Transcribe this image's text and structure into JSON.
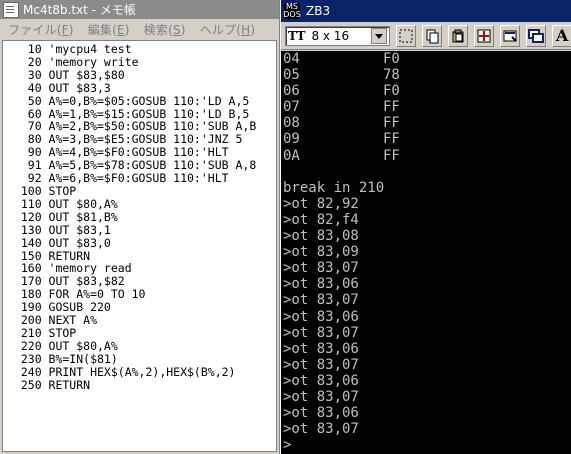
{
  "left_window": {
    "title": "Mc4t8b.txt - メモ帳",
    "menu": [
      {
        "label": "ファイル(",
        "hotkey": "F",
        "suffix": ")"
      },
      {
        "label": "編集(",
        "hotkey": "E",
        "suffix": ")"
      },
      {
        "label": "検索(",
        "hotkey": "S",
        "suffix": ")"
      },
      {
        "label": "ヘルプ(",
        "hotkey": "H",
        "suffix": ")"
      }
    ],
    "code_lines": [
      "   10 'mycpu4 test",
      "   20 'memory write",
      "   30 OUT $83,$80",
      "   40 OUT $83,3",
      "   50 A%=0,B%=$05:GOSUB 110:'LD A,5",
      "   60 A%=1,B%=$15:GOSUB 110:'LD B,5",
      "   70 A%=2,B%=$50:GOSUB 110:'SUB A,B",
      "   80 A%=3,B%=$E5:GOSUB 110:'JNZ 5",
      "   90 A%=4,B%=$F0:GOSUB 110:'HLT",
      "   91 A%=5,B%=$78:GOSUB 110:'SUB A,8",
      "   92 A%=6,B%=$F0:GOSUB 110:'HLT",
      "  100 STOP",
      "  110 OUT $80,A%",
      "  120 OUT $81,B%",
      "  130 OUT $83,1",
      "  140 OUT $83,0",
      "  150 RETURN",
      "  160 'memory read",
      "  170 OUT $83,$82",
      "  180 FOR A%=0 TO 10",
      "  190 GOSUB 220",
      "  200 NEXT A%",
      "  210 STOP",
      "  220 OUT $80,A%",
      "  230 B%=IN($81)",
      "  240 PRINT HEX$(A%,2),HEX$(B%,2)",
      "  250 RETURN"
    ]
  },
  "right_window": {
    "title": "ZB3",
    "font_size_value": "8 x 16",
    "toolbar_buttons": [
      {
        "name": "select-icon"
      },
      {
        "name": "copy-icon"
      },
      {
        "name": "paste-icon"
      },
      {
        "name": "fullscreen-icon"
      },
      {
        "name": "properties-icon"
      },
      {
        "name": "background-icon"
      },
      {
        "name": "font-icon",
        "label": "A"
      }
    ],
    "memory_rows": [
      {
        "addr": "04",
        "val": "F0"
      },
      {
        "addr": "05",
        "val": "78"
      },
      {
        "addr": "06",
        "val": "F0"
      },
      {
        "addr": "07",
        "val": "FF"
      },
      {
        "addr": "08",
        "val": "FF"
      },
      {
        "addr": "09",
        "val": "FF"
      },
      {
        "addr": "0A",
        "val": "FF"
      }
    ],
    "console_lines": [
      "break in 210",
      ">ot 82,92",
      ">ot 82,f4",
      ">ot 83,08",
      ">ot 83,09",
      ">ot 83,07",
      ">ot 83,06",
      ">ot 83,07",
      ">ot 83,06",
      ">ot 83,07",
      ">ot 83,06",
      ">ot 83,07",
      ">ot 83,06",
      ">ot 83,07",
      ">ot 83,06",
      ">ot 83,07",
      ">"
    ],
    "colors": {
      "console_bg": "#000000",
      "console_fg": "#c0c0c0",
      "title_active": "#0a246a"
    }
  }
}
